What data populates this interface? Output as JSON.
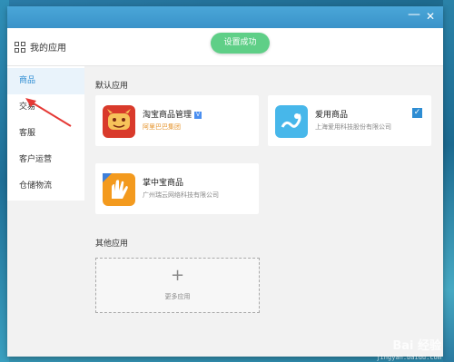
{
  "window": {
    "minimize_glyph": "—",
    "close_glyph": "✕"
  },
  "header": {
    "title": "我的应用",
    "toast": "设置成功"
  },
  "sidebar": {
    "items": [
      {
        "label": "商品",
        "active": true
      },
      {
        "label": "交易"
      },
      {
        "label": "客服"
      },
      {
        "label": "客户运营"
      },
      {
        "label": "仓储物流"
      }
    ]
  },
  "sections": {
    "default_title": "默认应用",
    "other_title": "其他应用"
  },
  "apps": [
    {
      "name": "淘宝商品管理",
      "company": "阿里巴巴集团",
      "verified": true,
      "icon_color": "#d93a2b"
    },
    {
      "name": "爱用商品",
      "company": "上海爱用科技股份有限公司",
      "checked": true,
      "icon_color": "#47b7ea"
    },
    {
      "name": "掌中宝商品",
      "company": "广州瑞云网络科技有限公司",
      "icon_color": "#f39a1e"
    }
  ],
  "more": {
    "plus": "+",
    "label": "更多应用"
  },
  "watermark": {
    "text": "Bai 经验",
    "sub": "jingyan.baidu.com"
  },
  "colors": {
    "accent": "#2e8dd3",
    "toast": "#5fcf87",
    "titlebar": "#3a93c9"
  }
}
